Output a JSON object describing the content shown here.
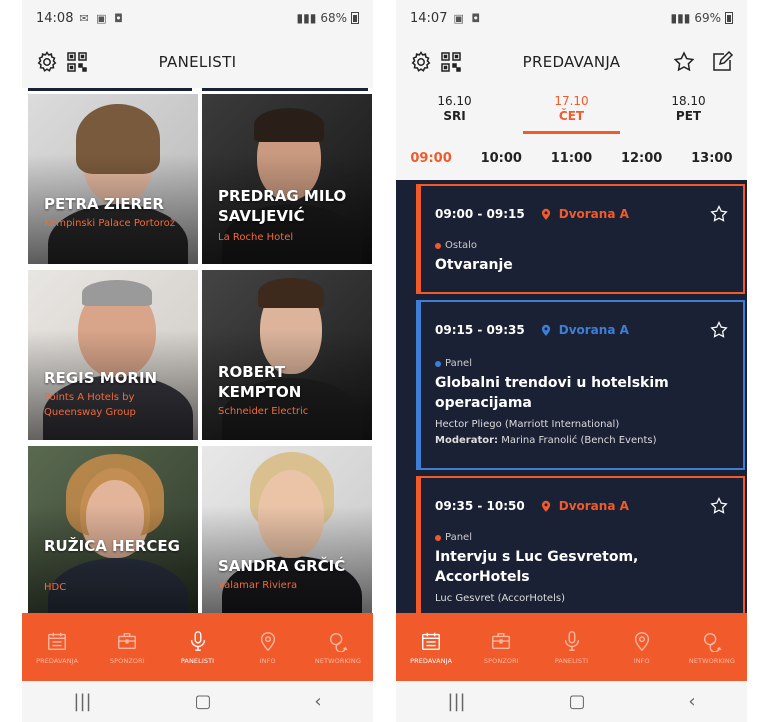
{
  "left": {
    "status": {
      "time": "14:08",
      "battery": "68%"
    },
    "header": {
      "title": "PANELISTI"
    },
    "panelists": [
      {
        "name": "PETRA ZIERER",
        "company": "Kempinski Palace Portorož"
      },
      {
        "name": "PREDRAG MILO SAVLJEVIĆ",
        "company": "La Roche Hotel"
      },
      {
        "name": "REGIS MORIN",
        "company": "Points A Hotels by Queensway Group"
      },
      {
        "name": "ROBERT KEMPTON",
        "company": "Schneider Electric"
      },
      {
        "name": "RUŽICA HERCEG",
        "company": "HDC"
      },
      {
        "name": "SANDRA GRČIĆ",
        "company": "Valamar Riviera"
      }
    ]
  },
  "right": {
    "status": {
      "time": "14:07",
      "battery": "69%"
    },
    "header": {
      "title": "PREDAVANJA"
    },
    "days": [
      {
        "date": "16.10",
        "label": "SRI"
      },
      {
        "date": "17.10",
        "label": "ČET"
      },
      {
        "date": "18.10",
        "label": "PET"
      }
    ],
    "hours": [
      "09:00",
      "10:00",
      "11:00",
      "12:00",
      "13:00"
    ],
    "sessions": [
      {
        "time": "09:00 - 09:15",
        "hall": "Dvorana A",
        "category": "Ostalo",
        "title": "Otvaranje"
      },
      {
        "time": "09:15 - 09:35",
        "hall": "Dvorana A",
        "category": "Panel",
        "title": "Globalni trendovi u hotelskim operacijama",
        "speaker": "Hector Pliego (Marriott International)",
        "moderator_label": "Moderator:",
        "moderator": "Marina Franolić (Bench Events)"
      },
      {
        "time": "09:35 - 10:50",
        "hall": "Dvorana A",
        "category": "Panel",
        "title": "Intervju s Luc Gesvretom, AccorHotels",
        "speaker": "Luc Gesvret (AccorHotels)"
      }
    ]
  },
  "nav": {
    "items": [
      "PREDAVANJA",
      "SPONZORI",
      "PANELISTI",
      "INFO",
      "NETWORKING"
    ]
  },
  "colors": {
    "accent": "#f15a2b",
    "dark": "#1b2134",
    "panel": "#3d7fd6"
  }
}
